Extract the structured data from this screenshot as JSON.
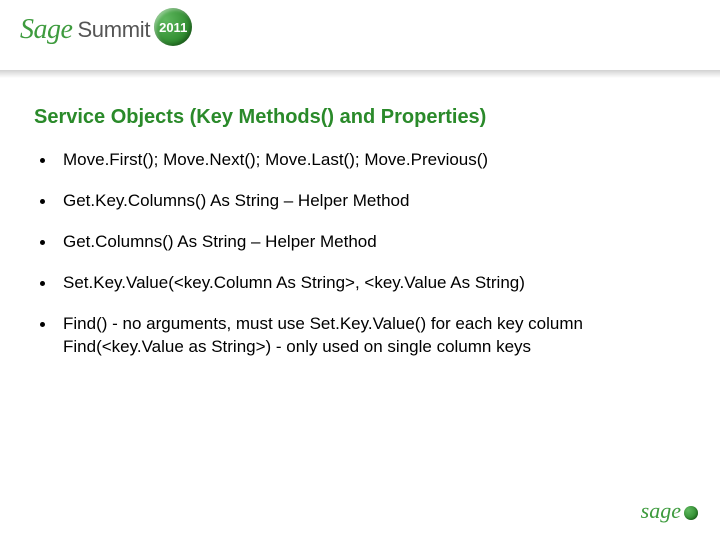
{
  "header": {
    "brand": "Sage",
    "event": "Summit",
    "year": "2011"
  },
  "slide": {
    "title": "Service Objects (Key Methods() and Properties)",
    "bullets": [
      "Move.First(); Move.Next(); Move.Last(); Move.Previous()",
      "Get.Key.Columns() As String – Helper Method",
      "Get.Columns() As String – Helper Method",
      "Set.Key.Value(<key.Column As String>, <key.Value As String)",
      "Find() - no arguments, must use Set.Key.Value() for each key column\nFind(<key.Value as String>)  - only used on single column keys"
    ]
  },
  "footer": {
    "brand": "sage"
  }
}
